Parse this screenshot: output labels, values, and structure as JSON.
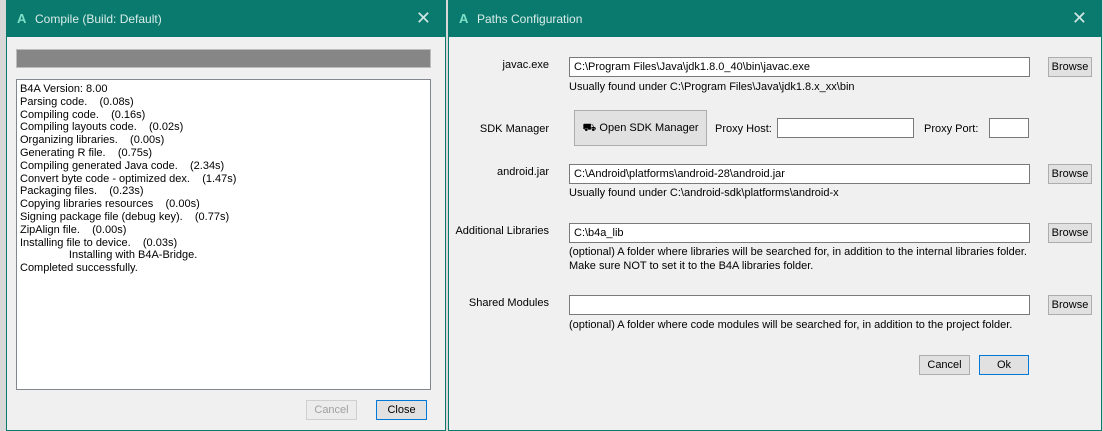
{
  "compile": {
    "title": "Compile (Build: Default)",
    "progress": 1.0,
    "log": [
      "B4A Version: 8.00",
      "Parsing code.    (0.08s)",
      "Compiling code.    (0.16s)",
      "Compiling layouts code.    (0.02s)",
      "Organizing libraries.    (0.00s)",
      "Generating R file.    (0.75s)",
      "Compiling generated Java code.    (2.34s)",
      "Convert byte code - optimized dex.    (1.47s)",
      "Packaging files.    (0.23s)",
      "Copying libraries resources    (0.00s)",
      "Signing package file (debug key).    (0.77s)",
      "ZipAlign file.    (0.00s)",
      "Installing file to device.    (0.03s)",
      "\t\tInstalling with B4A-Bridge.",
      "Completed successfully."
    ],
    "cancel": "Cancel",
    "close": "Close"
  },
  "paths": {
    "title": "Paths Configuration",
    "javac_label": "javac.exe",
    "javac_value": "C:\\Program Files\\Java\\jdk1.8.0_40\\bin\\javac.exe",
    "javac_hint": "Usually found under C:\\Program Files\\Java\\jdk1.8.x_xx\\bin",
    "sdk_label": "SDK Manager",
    "sdk_button": "Open SDK Manager",
    "proxy_host": "Proxy Host:",
    "proxy_port": "Proxy Port:",
    "android_label": "android.jar",
    "android_value": "C:\\Android\\platforms\\android-28\\android.jar",
    "android_hint": "Usually found under C:\\android-sdk\\platforms\\android-x",
    "libs_label": "Additional Libraries",
    "libs_value": "C:\\b4a_lib",
    "libs_hint1": "(optional) A folder where libraries will be searched for, in addition to the internal libraries folder.",
    "libs_hint2": "Make sure NOT to set it to the B4A libraries folder.",
    "shared_label": "Shared Modules",
    "shared_value": "",
    "shared_hint": "(optional) A folder where code modules will be searched for, in addition to the project folder.",
    "browse": "Browse",
    "cancel": "Cancel",
    "ok": "Ok"
  }
}
